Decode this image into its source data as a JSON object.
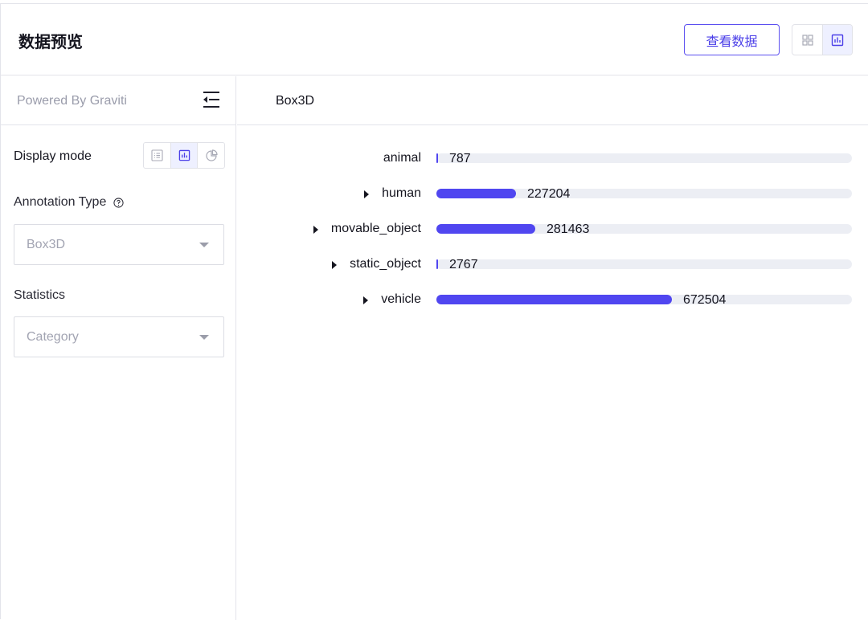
{
  "header": {
    "title": "数据预览",
    "view_data_label": "查看数据"
  },
  "icons": {
    "grid_view": "grid-icon",
    "chart_view": "bar-chart-icon",
    "collapse": "collapse-sidebar-icon",
    "list_mode": "list-icon",
    "bar_mode": "bar-chart-icon",
    "pie_mode": "pie-chart-icon",
    "help": "help-icon",
    "dropdown": "caret-down-icon",
    "expand": "caret-right-icon"
  },
  "colors": {
    "accent": "#5046f0",
    "track": "#eceef4"
  },
  "sidebar": {
    "powered_by": "Powered By Graviti",
    "display_mode_label": "Display mode",
    "annotation_type_label": "Annotation Type",
    "annotation_type_value": "Box3D",
    "statistics_label": "Statistics",
    "statistics_value": "Category"
  },
  "main": {
    "tab": "Box3D"
  },
  "chart_data": {
    "type": "bar",
    "orientation": "horizontal",
    "categories": [
      "animal",
      "human",
      "movable_object",
      "static_object",
      "vehicle"
    ],
    "values": [
      787,
      227204,
      281463,
      2767,
      672504
    ],
    "expandable": [
      false,
      true,
      true,
      true,
      true
    ]
  }
}
